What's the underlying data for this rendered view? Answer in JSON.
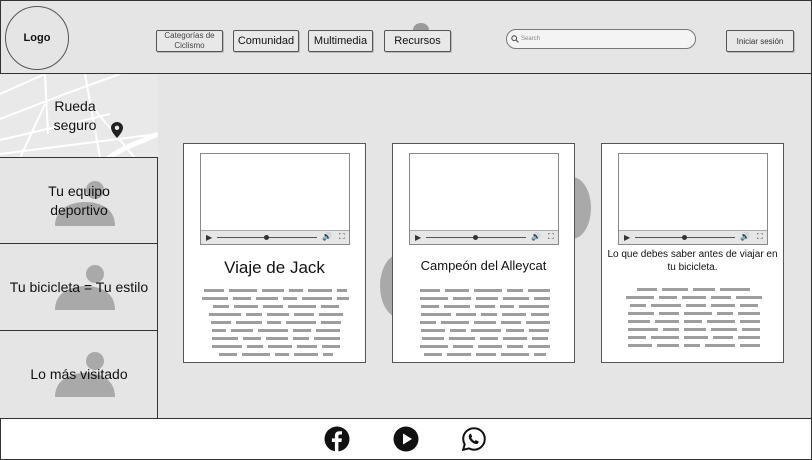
{
  "header": {
    "logo": "Logo",
    "nav": {
      "categories": "Categorías de Ciclismo",
      "community": "Comunidad",
      "multimedia": "Multimedia",
      "resources": "Recursos"
    },
    "search_placeholder": "Search",
    "login": "Iniciar sesión"
  },
  "sidebar": {
    "items": [
      {
        "label": "Rueda seguro"
      },
      {
        "label": "Tu equipo deportivo"
      },
      {
        "label": "Tu bicicleta = Tu estilo"
      },
      {
        "label": "Lo más visitado"
      }
    ]
  },
  "cards": [
    {
      "title": "Viaje de Jack"
    },
    {
      "title": "Campeón del Alleycat"
    },
    {
      "title": "Lo que debes saber antes de viajar en tu bicicleta."
    }
  ],
  "footer": {
    "icons": [
      "facebook-icon",
      "youtube-icon",
      "whatsapp-icon"
    ]
  },
  "colors": {
    "background": "#e5e5e5",
    "placeholder": "#9e9e9e",
    "border": "#333333"
  }
}
